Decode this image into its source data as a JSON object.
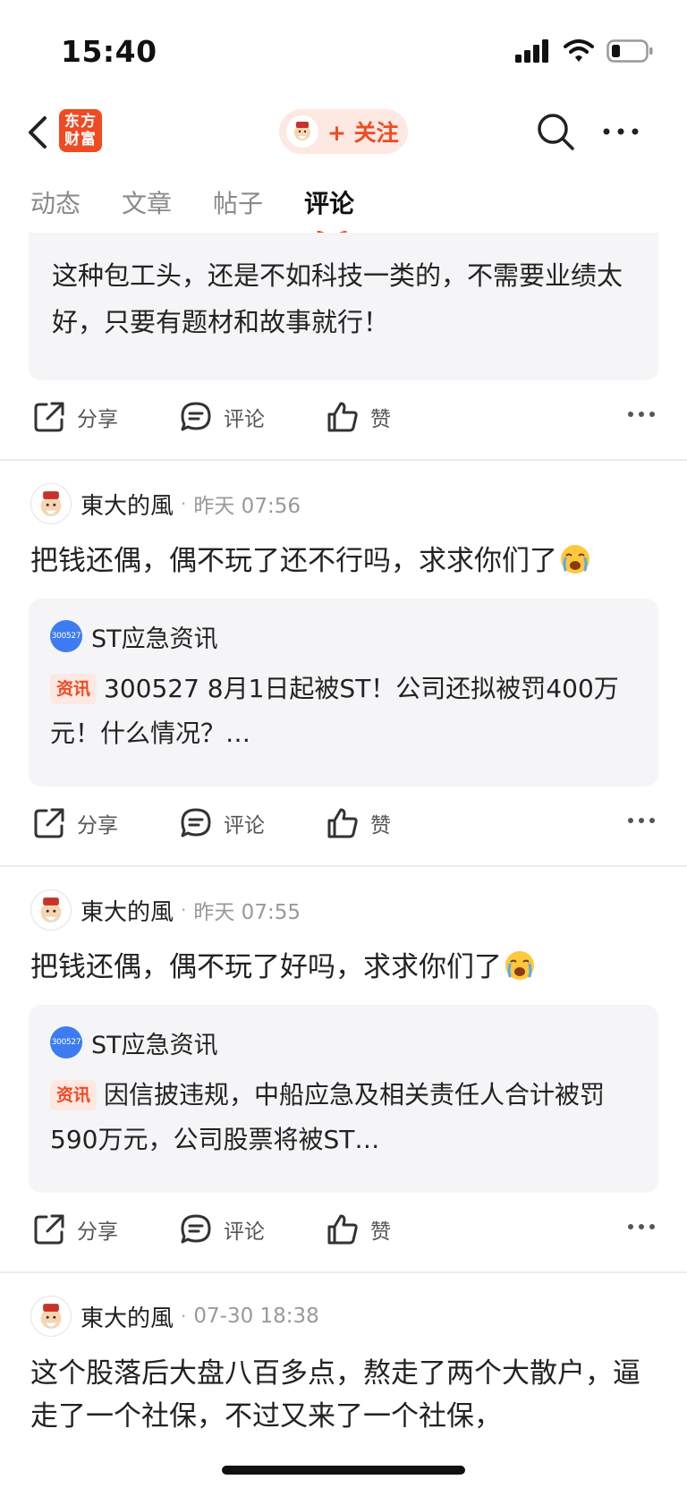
{
  "status_bar": {
    "time": "15:40"
  },
  "nav": {
    "app_logo_line1": "东方",
    "app_logo_line2": "财富",
    "follow_label": "+ 关注"
  },
  "tabs": [
    {
      "label": "动态",
      "active": false
    },
    {
      "label": "文章",
      "active": false
    },
    {
      "label": "帖子",
      "active": false
    },
    {
      "label": "评论",
      "active": true
    }
  ],
  "first_quote": {
    "text": "这种包工头，还是不如科技一类的，不需要业绩太好，只要有题材和故事就行！"
  },
  "actions": {
    "share": "分享",
    "comment": "评论",
    "like": "赞"
  },
  "posts": [
    {
      "username": "東大的風",
      "time": "昨天 07:56",
      "text": "把钱还偶，偶不玩了还不行吗，求求你们了",
      "ref_logo": "300527",
      "ref_name": "ST应急资讯",
      "badge": "资讯",
      "ref_text": "300527 8月1日起被ST！公司还拟被罚400万元！什么情况？…"
    },
    {
      "username": "東大的風",
      "time": "昨天 07:55",
      "text": "把钱还偶，偶不玩了好吗，求求你们了",
      "ref_logo": "300527",
      "ref_name": "ST应急资讯",
      "badge": "资讯",
      "ref_text": "因信披违规，中船应急及相关责任人合计被罚590万元，公司股票将被ST…"
    },
    {
      "username": "東大的風",
      "time": "07-30 18:38",
      "text": "这个股落后大盘八百多点，熬走了两个大散户，逼走了一个社保，不过又来了一个社保，"
    }
  ],
  "colors": {
    "accent": "#f04a23",
    "badge_bg": "#fde8e2",
    "card_bg": "#f5f5f7",
    "ref_logo_bg": "#3d7cf0"
  }
}
